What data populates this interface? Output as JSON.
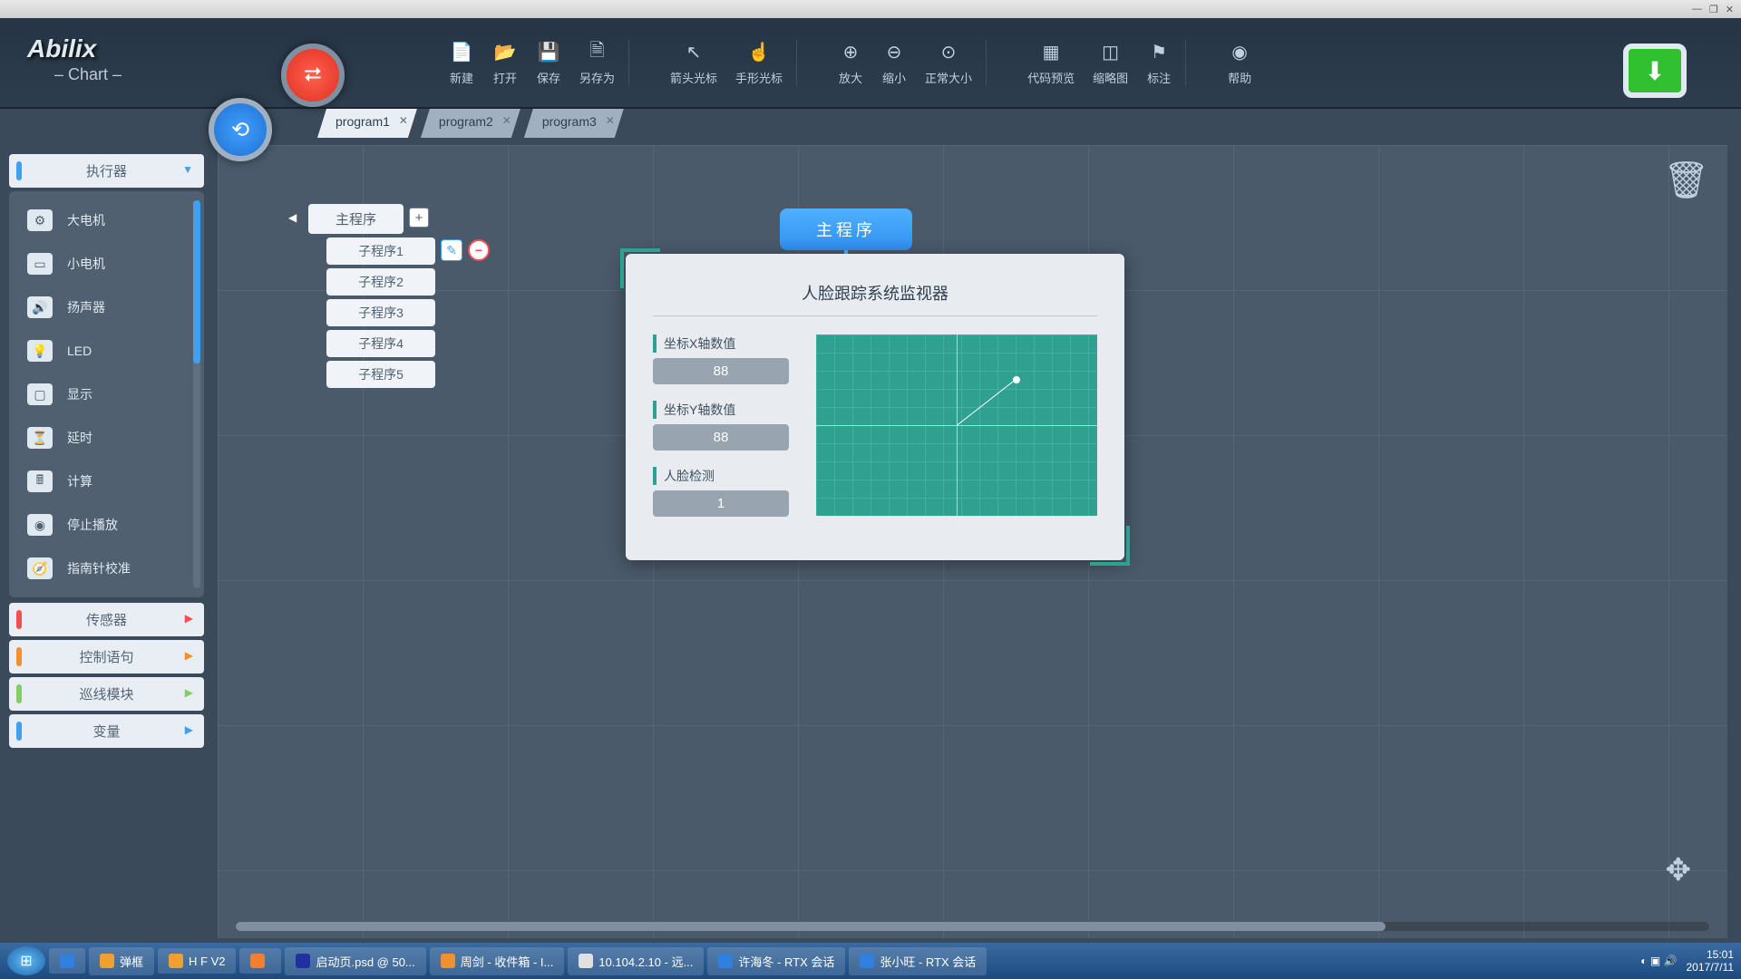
{
  "app": {
    "name": "Abilix",
    "subtitle": "– Chart –"
  },
  "window_controls": {
    "min": "—",
    "max": "❐",
    "close": "✕"
  },
  "toolbar": {
    "file": [
      {
        "icon": "📄",
        "label": "新建"
      },
      {
        "icon": "📂",
        "label": "打开"
      },
      {
        "icon": "💾",
        "label": "保存"
      },
      {
        "icon": "🗎",
        "label": "另存为"
      }
    ],
    "cursor": [
      {
        "icon": "↖",
        "label": "箭头光标"
      },
      {
        "icon": "☝",
        "label": "手形光标"
      }
    ],
    "zoom": [
      {
        "icon": "⊕",
        "label": "放大"
      },
      {
        "icon": "⊖",
        "label": "缩小"
      },
      {
        "icon": "⊙",
        "label": "正常大小"
      }
    ],
    "view": [
      {
        "icon": "▦",
        "label": "代码预览"
      },
      {
        "icon": "◫",
        "label": "缩略图"
      },
      {
        "icon": "⚑",
        "label": "标注"
      }
    ],
    "help": [
      {
        "icon": "◉",
        "label": "帮助"
      }
    ]
  },
  "tabs": [
    {
      "label": "program1",
      "active": true
    },
    {
      "label": "program2",
      "active": false
    },
    {
      "label": "program3",
      "active": false
    }
  ],
  "sidebar": {
    "actuator": {
      "title": "执行器",
      "items": [
        {
          "label": "大电机"
        },
        {
          "label": "小电机"
        },
        {
          "label": "扬声器"
        },
        {
          "label": "LED"
        },
        {
          "label": "显示"
        },
        {
          "label": "延时"
        },
        {
          "label": "计算"
        },
        {
          "label": "停止播放"
        },
        {
          "label": "指南针校准"
        }
      ]
    },
    "categories": [
      {
        "title": "传感器",
        "color": "red"
      },
      {
        "title": "控制语句",
        "color": "orange"
      },
      {
        "title": "巡线模块",
        "color": "green"
      },
      {
        "title": "变量",
        "color": "blue"
      }
    ]
  },
  "program_tree": {
    "main": "主程序",
    "subs": [
      "子程序1",
      "子程序2",
      "子程序3",
      "子程序4",
      "子程序5"
    ]
  },
  "canvas_block": "主程序",
  "dialog": {
    "title": "人脸跟踪系统监视器",
    "fields": [
      {
        "label": "坐标X轴数值",
        "value": "88"
      },
      {
        "label": "坐标Y轴数值",
        "value": "88"
      },
      {
        "label": "人脸检测",
        "value": "1"
      }
    ]
  },
  "taskbar": {
    "items": [
      {
        "label": "弹框"
      },
      {
        "label": "H F  V2"
      },
      {
        "label": ""
      },
      {
        "label": "启动页.psd @ 50..."
      },
      {
        "label": "周剑 - 收件箱 - I..."
      },
      {
        "label": "10.104.2.10 - 远..."
      },
      {
        "label": "许海冬 - RTX 会话"
      },
      {
        "label": "张小旺 - RTX 会话"
      }
    ],
    "time": "15:01",
    "date": "2017/7/11"
  }
}
